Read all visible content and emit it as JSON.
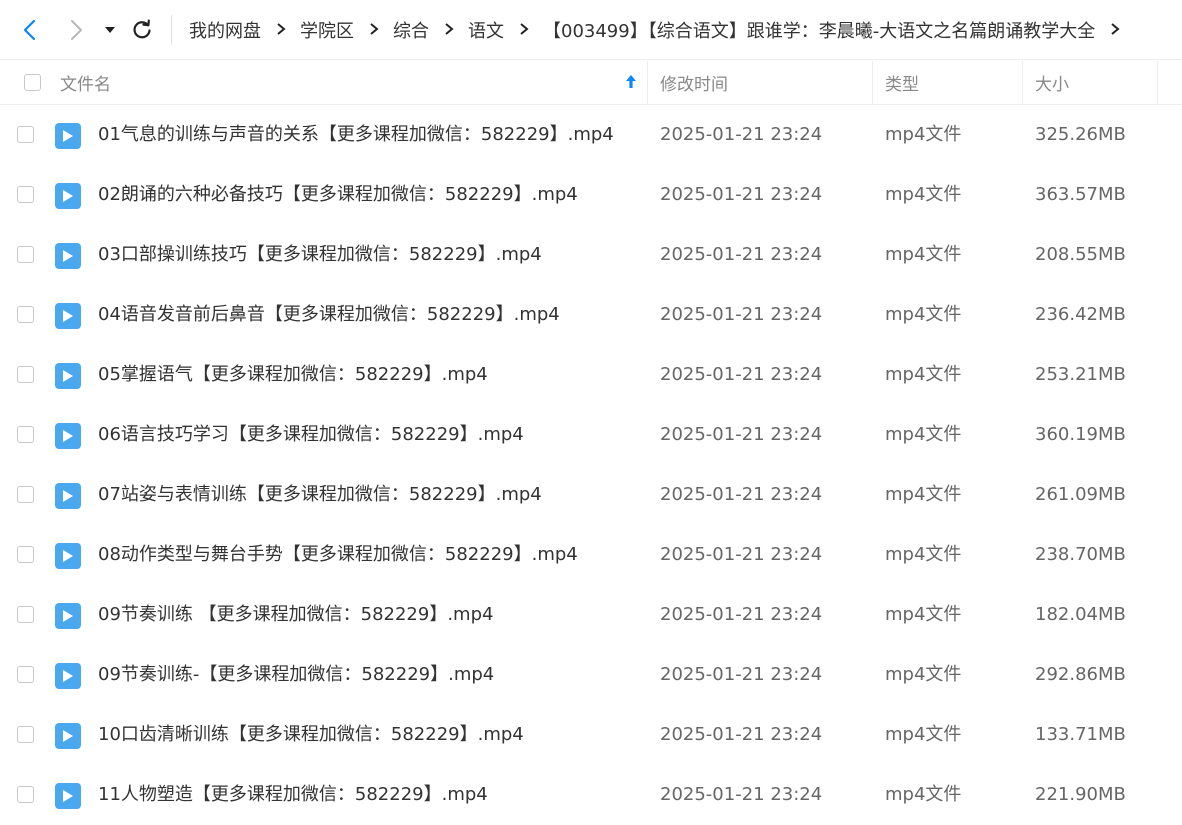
{
  "colors": {
    "accent": "#0a84ff",
    "file_icon": "#4aa8ee",
    "text": "#333333",
    "muted": "#888888"
  },
  "toolbar": {
    "back_icon": "chevron-left-icon",
    "forward_icon": "chevron-right-icon",
    "history_icon": "caret-down-icon",
    "refresh_icon": "refresh-icon"
  },
  "breadcrumb": [
    "我的网盘",
    "学院区",
    "综合",
    "语文",
    "【003499】【综合语文】跟谁学：李晨曦-大语文之名篇朗诵教学大全"
  ],
  "table": {
    "columns": {
      "name": "文件名",
      "time": "修改时间",
      "type": "类型",
      "size": "大小"
    },
    "sort_icon": "sort-up-arrow-icon",
    "rows": [
      {
        "name": "01气息的训练与声音的关系【更多课程加微信：582229】.mp4",
        "time": "2025-01-21 23:24",
        "type": "mp4文件",
        "size": "325.26MB"
      },
      {
        "name": "02朗诵的六种必备技巧【更多课程加微信：582229】.mp4",
        "time": "2025-01-21 23:24",
        "type": "mp4文件",
        "size": "363.57MB"
      },
      {
        "name": "03口部操训练技巧【更多课程加微信：582229】.mp4",
        "time": "2025-01-21 23:24",
        "type": "mp4文件",
        "size": "208.55MB"
      },
      {
        "name": "04语音发音前后鼻音【更多课程加微信：582229】.mp4",
        "time": "2025-01-21 23:24",
        "type": "mp4文件",
        "size": "236.42MB"
      },
      {
        "name": "05掌握语气【更多课程加微信：582229】.mp4",
        "time": "2025-01-21 23:24",
        "type": "mp4文件",
        "size": "253.21MB"
      },
      {
        "name": "06语言技巧学习【更多课程加微信：582229】.mp4",
        "time": "2025-01-21 23:24",
        "type": "mp4文件",
        "size": "360.19MB"
      },
      {
        "name": "07站姿与表情训练【更多课程加微信：582229】.mp4",
        "time": "2025-01-21 23:24",
        "type": "mp4文件",
        "size": "261.09MB"
      },
      {
        "name": "08动作类型与舞台手势【更多课程加微信：582229】.mp4",
        "time": "2025-01-21 23:24",
        "type": "mp4文件",
        "size": "238.70MB"
      },
      {
        "name": "09节奏训练 【更多课程加微信：582229】.mp4",
        "time": "2025-01-21 23:24",
        "type": "mp4文件",
        "size": "182.04MB"
      },
      {
        "name": "09节奏训练-【更多课程加微信：582229】.mp4",
        "time": "2025-01-21 23:24",
        "type": "mp4文件",
        "size": "292.86MB"
      },
      {
        "name": "10口齿清晰训练【更多课程加微信：582229】.mp4",
        "time": "2025-01-21 23:24",
        "type": "mp4文件",
        "size": "133.71MB"
      },
      {
        "name": "11人物塑造【更多课程加微信：582229】.mp4",
        "time": "2025-01-21 23:24",
        "type": "mp4文件",
        "size": "221.90MB"
      }
    ]
  }
}
